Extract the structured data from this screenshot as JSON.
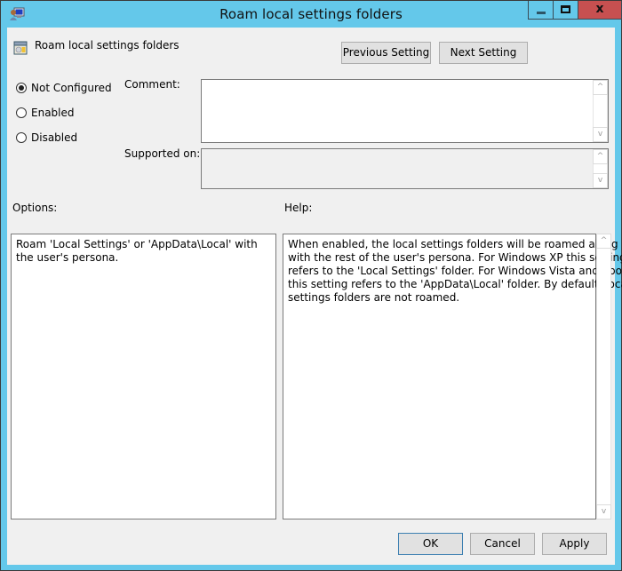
{
  "window": {
    "title": "Roam local settings folders",
    "icons": {
      "app": "group-policy-editor-icon",
      "minimize": "minimize-icon",
      "maximize": "maximize-icon",
      "close": "close-icon"
    },
    "close_glyph": "x"
  },
  "header": {
    "policy_name": "Roam local settings folders",
    "policy_icon": "policy-setting-icon",
    "previous_label": "Previous Setting",
    "next_label": "Next Setting"
  },
  "state": {
    "options": [
      {
        "label": "Not Configured",
        "checked": true
      },
      {
        "label": "Enabled",
        "checked": false
      },
      {
        "label": "Disabled",
        "checked": false
      }
    ],
    "selected": "Not Configured"
  },
  "comment": {
    "label": "Comment:",
    "value": ""
  },
  "supported_on": {
    "label": "Supported on:",
    "value": ""
  },
  "options_panel": {
    "label": "Options:",
    "text": "Roam 'Local Settings' or 'AppData\\Local' with the user's persona."
  },
  "help_panel": {
    "label": "Help:",
    "lines": [
      "When enabled, the local settings folders will be roamed along",
      "with the rest of the user's persona. For Windows XP this setting",
      "refers to the 'Local Settings' folder. For Windows Vista and above",
      "this setting refers to the 'AppData\\Local' folder. By default, local",
      "settings folders are not roamed."
    ]
  },
  "footer": {
    "ok_label": "OK",
    "cancel_label": "Cancel",
    "apply_label": "Apply"
  },
  "scroll_glyphs": {
    "up": "^",
    "down": "v"
  },
  "colors": {
    "titlebar": "#64c8ea",
    "close_button": "#c75050",
    "dialog_bg": "#f0f0f0",
    "default_button_border": "#3c7fb1"
  }
}
